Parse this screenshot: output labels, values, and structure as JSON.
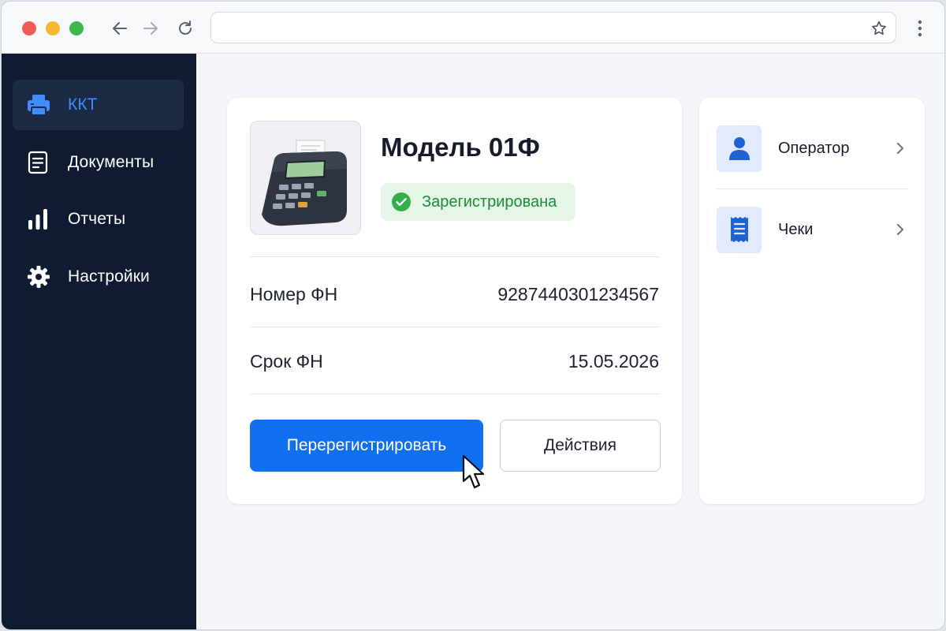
{
  "browser": {
    "url": "",
    "icons": [
      "arrow-left-icon",
      "arrow-right-icon",
      "reload-icon",
      "star-icon",
      "more-vertical-icon"
    ]
  },
  "sidebar": {
    "items": [
      {
        "label": "ККТ",
        "icon": "printer-icon",
        "active": true
      },
      {
        "label": "Документы",
        "icon": "document-icon",
        "active": false
      },
      {
        "label": "Отчеты",
        "icon": "bar-chart-icon",
        "active": false
      },
      {
        "label": "Настройки",
        "icon": "gear-icon",
        "active": false
      }
    ]
  },
  "device": {
    "model": "Модель 01Ф",
    "status": "Зарегистрирована",
    "fields": [
      {
        "label": "Номер ФН",
        "value": "9287440301234567"
      },
      {
        "label": "Срок ФН",
        "value": "15.05.2026"
      }
    ],
    "primary_action": "Перерегистрировать",
    "secondary_action": "Действия"
  },
  "side_panel": {
    "links": [
      {
        "label": "Оператор",
        "icon": "user-icon"
      },
      {
        "label": "Чеки",
        "icon": "receipt-icon"
      }
    ]
  },
  "colors": {
    "sidebar_bg": "#0f1b30",
    "accent": "#1170f0",
    "active_text": "#3f8cff",
    "status_green": "#1f8a35",
    "status_bg": "#e5f5e7"
  }
}
